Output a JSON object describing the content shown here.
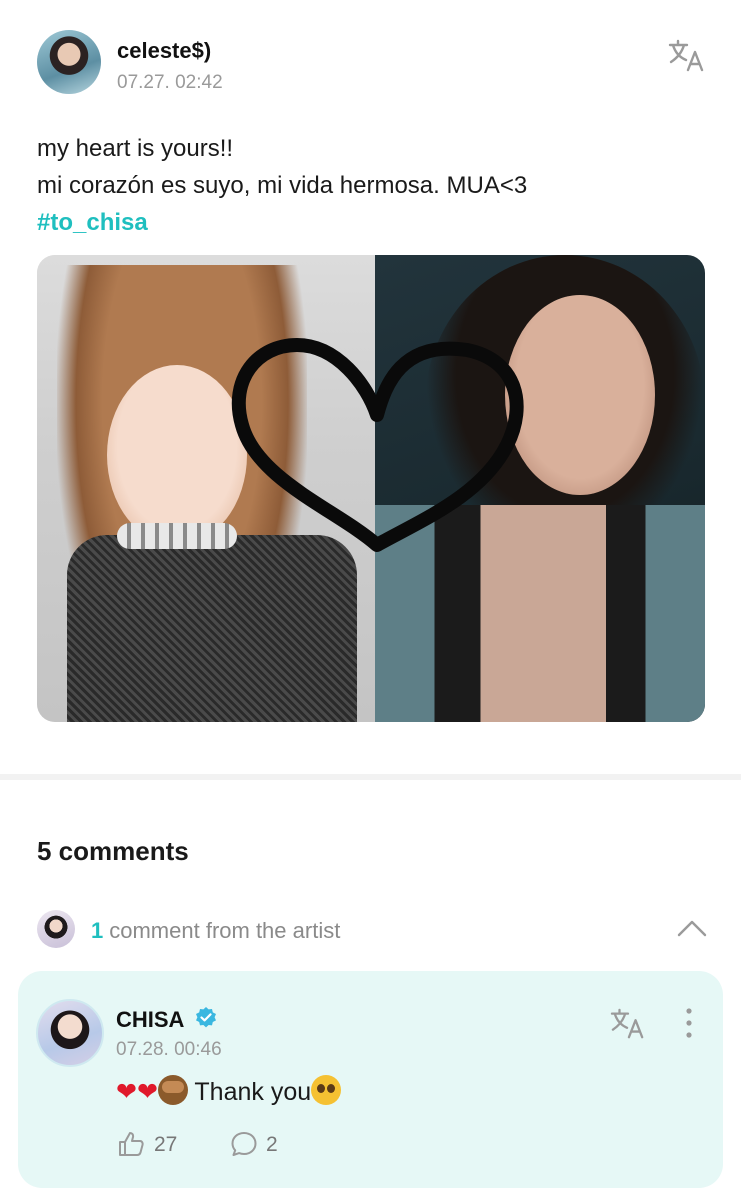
{
  "post": {
    "author": "celeste$)",
    "timestamp": "07.27. 02:42",
    "lines": [
      "my heart is yours!!",
      "mi corazón es suyo, mi vida hermosa. MUA<3"
    ],
    "hashtag": "#to_chisa"
  },
  "comments_header": {
    "count_label": "5 comments",
    "artist_count": "1",
    "artist_label": "comment from the artist"
  },
  "artist_comment": {
    "name": "CHISA",
    "timestamp": "07.28. 00:46",
    "text": "Thank you",
    "likes": "27",
    "replies": "2"
  },
  "icons": {
    "translate": "translate-icon",
    "chevron": "chevron-up-icon",
    "verified": "verified-badge-icon",
    "more": "more-vertical-icon",
    "like": "like-icon",
    "reply": "reply-icon"
  },
  "colors": {
    "accent": "#1fbfbf",
    "comment_card_bg": "#e6f8f6",
    "muted_text": "#9a9a9a",
    "verified": "#3ab7e0"
  }
}
